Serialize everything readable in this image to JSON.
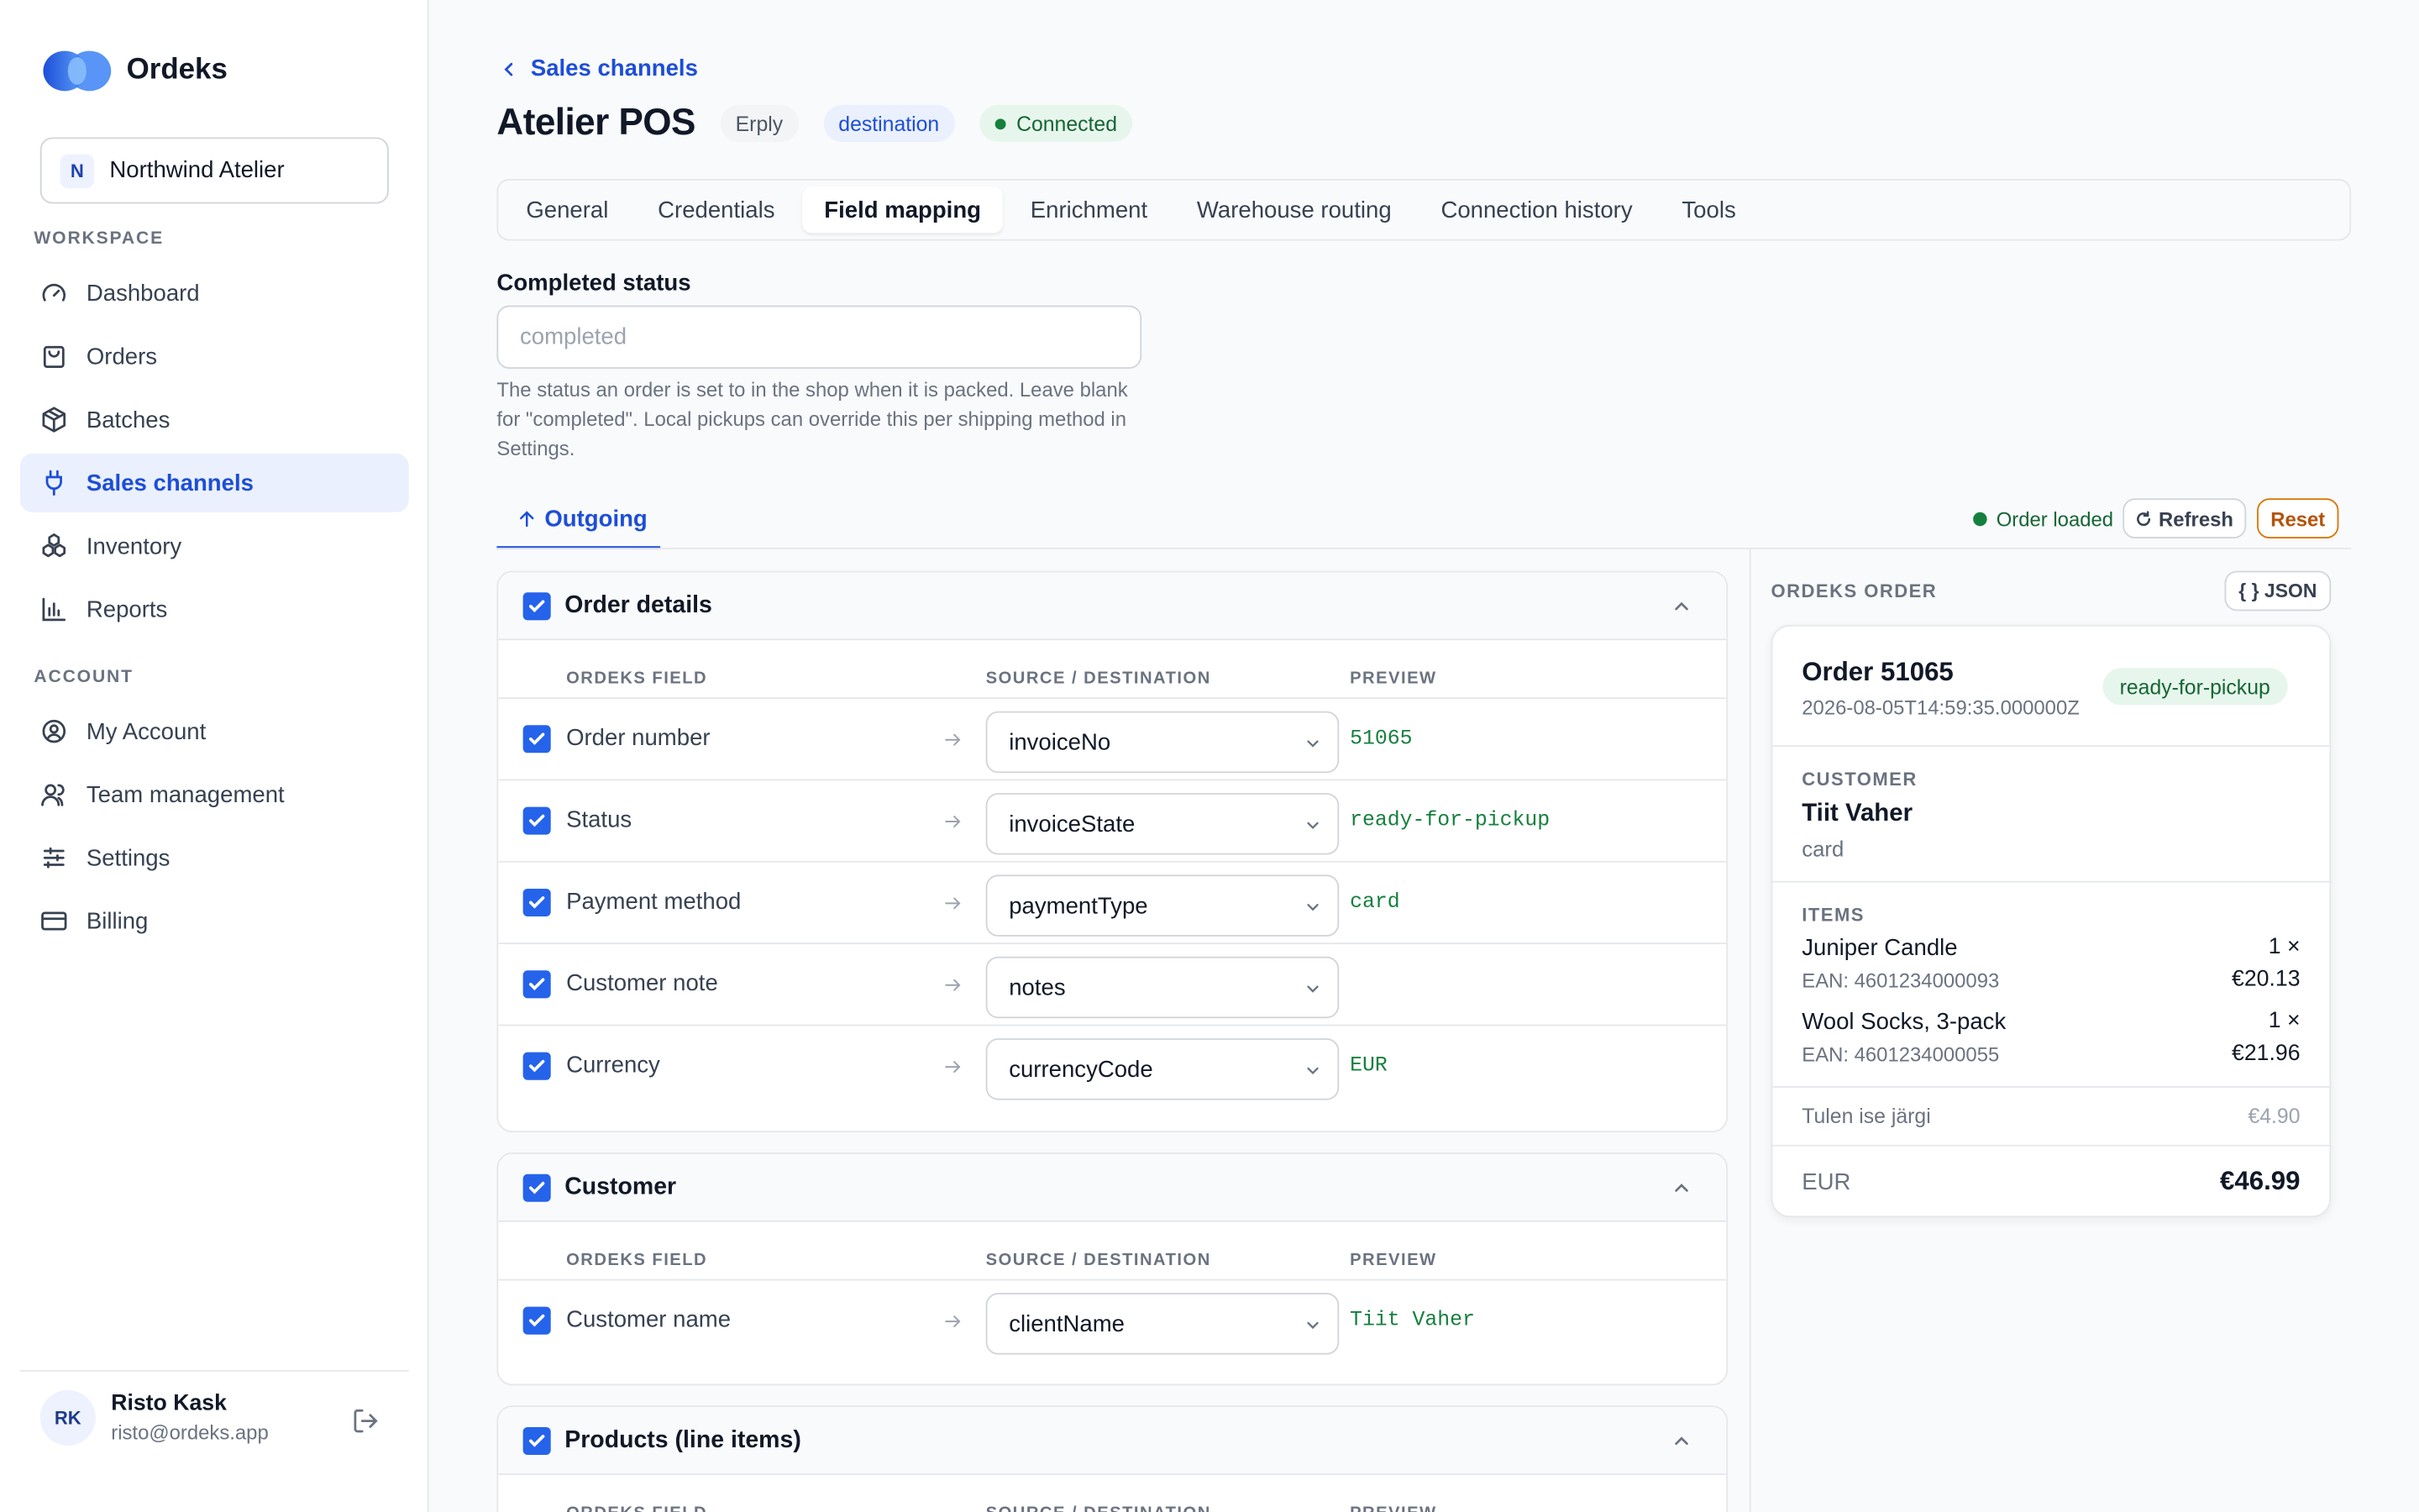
{
  "app": {
    "name": "Ordeks"
  },
  "org": {
    "initial": "N",
    "name": "Northwind Atelier"
  },
  "nav": {
    "workspace_label": "WORKSPACE",
    "account_label": "ACCOUNT",
    "items": [
      {
        "label": "Dashboard",
        "icon": "gauge-icon"
      },
      {
        "label": "Orders",
        "icon": "shopping-bag-icon"
      },
      {
        "label": "Batches",
        "icon": "box-icon"
      },
      {
        "label": "Sales channels",
        "icon": "plug-icon",
        "active": true
      },
      {
        "label": "Inventory",
        "icon": "boxes-icon"
      },
      {
        "label": "Reports",
        "icon": "bar-chart-icon"
      }
    ],
    "account_items": [
      {
        "label": "My Account",
        "icon": "user-circle-icon"
      },
      {
        "label": "Team management",
        "icon": "users-icon"
      },
      {
        "label": "Settings",
        "icon": "sliders-icon"
      },
      {
        "label": "Billing",
        "icon": "credit-card-icon"
      }
    ]
  },
  "user": {
    "initials": "RK",
    "name": "Risto Kask",
    "email": "risto@ordeks.app"
  },
  "header": {
    "back_label": "Sales channels",
    "title": "Atelier POS",
    "badges": {
      "platform": "Erply",
      "direction": "destination",
      "status": "Connected"
    }
  },
  "tabs": [
    "General",
    "Credentials",
    "Field mapping",
    "Enrichment",
    "Warehouse routing",
    "Connection history",
    "Tools"
  ],
  "active_tab": "Field mapping",
  "completed_status": {
    "label": "Completed status",
    "value": "",
    "placeholder": "completed",
    "help": "The status an order is set to in the shop when it is packed. Leave blank for \"completed\". Local pickups can override this per shipping method in Settings."
  },
  "subtab": {
    "label": "Outgoing"
  },
  "toolbar": {
    "loaded_label": "Order loaded",
    "refresh_label": "Refresh",
    "reset_label": "Reset"
  },
  "columns": {
    "field": "ORDEKS FIELD",
    "source": "SOURCE / DESTINATION",
    "preview": "PREVIEW"
  },
  "sections": [
    {
      "title": "Order details",
      "rows": [
        {
          "field": "Order number",
          "source": "invoiceNo",
          "preview": "51065"
        },
        {
          "field": "Status",
          "source": "invoiceState",
          "preview": "ready-for-pickup"
        },
        {
          "field": "Payment method",
          "source": "paymentType",
          "preview": "card"
        },
        {
          "field": "Customer note",
          "source": "notes",
          "preview": ""
        },
        {
          "field": "Currency",
          "source": "currencyCode",
          "preview": "EUR"
        }
      ]
    },
    {
      "title": "Customer",
      "rows": [
        {
          "field": "Customer name",
          "source": "clientName",
          "preview": "Tiit Vaher"
        }
      ]
    },
    {
      "title": "Products (line items)",
      "rows": []
    }
  ],
  "order_panel": {
    "label": "ORDEKS ORDER",
    "json_label": "{ } JSON",
    "order_number": "Order 51065",
    "timestamp": "2026-08-05T14:59:35.000000Z",
    "status": "ready-for-pickup",
    "customer_label": "CUSTOMER",
    "customer_name": "Tiit Vaher",
    "payment": "card",
    "items_label": "ITEMS",
    "items": [
      {
        "name": "Juniper Candle",
        "ean": "EAN: 4601234000093",
        "qty": "1 ×",
        "price": "€20.13"
      },
      {
        "name": "Wool Socks, 3-pack",
        "ean": "EAN: 4601234000055",
        "qty": "1 ×",
        "price": "€21.96"
      }
    ],
    "shipping_label": "Tulen ise järgi",
    "shipping_price": "€4.90",
    "currency": "EUR",
    "total": "€46.99"
  },
  "colors": {
    "accent": "#1d4ed8",
    "success": "#15803d",
    "warning": "#b45309",
    "checkbox": "#2563eb"
  }
}
